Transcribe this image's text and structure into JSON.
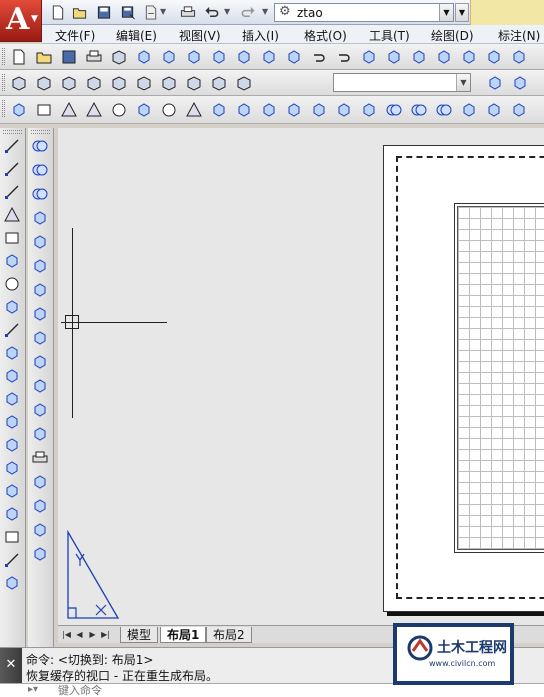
{
  "quick_access": {
    "workspace": "ztao",
    "icons": [
      "new-icon",
      "open-icon",
      "save-icon",
      "save-as-icon",
      "publish-icon",
      "print-icon",
      "undo-icon",
      "redo-icon"
    ]
  },
  "menubar": {
    "items": [
      "文件(F)",
      "编辑(E)",
      "视图(V)",
      "插入(I)",
      "格式(O)",
      "工具(T)",
      "绘图(D)",
      "标注(N)"
    ]
  },
  "toolbars": {
    "standard": [
      "new-icon",
      "open-icon",
      "save-icon",
      "plot-icon",
      "plot-preview-icon",
      "publish-icon",
      "3d-dwf-icon",
      "cut-icon",
      "copy-icon",
      "paste-icon",
      "match-properties-icon",
      "block-editor-icon",
      "undo-icon",
      "redo-icon",
      "pan-icon",
      "zoom-realtime-icon",
      "zoom-window-icon",
      "zoom-previous-icon",
      "properties-icon",
      "design-center-icon",
      "tool-palettes-icon",
      "sheet-set-icon",
      "markup-icon",
      "calculator-icon",
      "help-icon"
    ],
    "views": [
      "top-view-icon",
      "bottom-view-icon",
      "left-view-icon",
      "right-view-icon",
      "front-view-icon",
      "back-view-icon",
      "sw-iso-icon",
      "se-iso-icon",
      "ne-iso-icon",
      "nw-iso-icon",
      "camera-icon",
      "ucs-icon"
    ],
    "named_views_combo_value": "",
    "modeling": [
      "polysolid-icon",
      "box-icon",
      "wedge-icon",
      "cone-icon",
      "sphere-icon",
      "cylinder-icon",
      "torus-icon",
      "pyramid-icon",
      "helix-icon",
      "planar-surface-icon",
      "extrude-icon",
      "presspull-icon",
      "sweep-icon",
      "revolve-icon",
      "loft-icon",
      "union-icon",
      "subtract-icon",
      "intersect-icon",
      "3d-move-icon",
      "3d-rotate-icon",
      "3d-align-icon"
    ]
  },
  "left_toolbar_draw": [
    "line-icon",
    "construction-line-icon",
    "polyline-icon",
    "polygon-icon",
    "rectangle-icon",
    "arc-icon",
    "circle-icon",
    "revision-cloud-icon",
    "spline-icon",
    "ellipse-icon",
    "ellipse-arc-icon",
    "insert-block-icon",
    "make-block-icon",
    "point-icon",
    "hatch-icon",
    "gradient-icon",
    "region-icon",
    "table-icon",
    "multiline-text-icon",
    "add-selected-icon"
  ],
  "left_toolbar_solid_edit": [
    "union-icon",
    "subtract-icon",
    "intersect-icon",
    "extrude-faces-icon",
    "move-faces-icon",
    "offset-faces-icon",
    "delete-faces-icon",
    "rotate-faces-icon",
    "taper-faces-icon",
    "copy-faces-icon",
    "color-faces-icon",
    "copy-edges-icon",
    "color-edges-icon",
    "imprint-icon",
    "clean-icon",
    "separate-icon",
    "shell-icon",
    "check-icon"
  ],
  "layout_tabs": [
    "模型",
    "布局1",
    "布局2"
  ],
  "command": {
    "line1": "命令:    <切换到: 布局1>",
    "line2": "恢复缓存的视口 - 正在重生成布局。",
    "placeholder": "键入命令"
  },
  "watermark": {
    "name": "土木工程网",
    "url": "www.civilcn.com"
  },
  "colors": {
    "app_button": "#c0392b",
    "canvas": "#e7e7e7",
    "watermark_blue": "#1c3a6e"
  }
}
